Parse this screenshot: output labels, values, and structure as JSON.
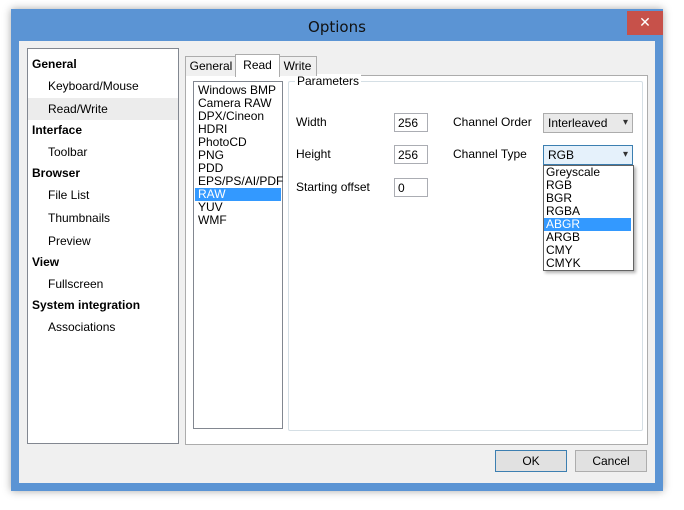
{
  "window": {
    "title": "Options",
    "close_glyph": "✕"
  },
  "nav": {
    "categories": [
      {
        "label": "General",
        "items": [
          "Keyboard/Mouse",
          "Read/Write"
        ]
      },
      {
        "label": "Interface",
        "items": [
          "Toolbar"
        ]
      },
      {
        "label": "Browser",
        "items": [
          "File List",
          "Thumbnails",
          "Preview"
        ]
      },
      {
        "label": "View",
        "items": [
          "Fullscreen"
        ]
      },
      {
        "label": "System integration",
        "items": [
          "Associations"
        ]
      }
    ],
    "selected": "Read/Write"
  },
  "tabs": {
    "items": [
      "General",
      "Read",
      "Write"
    ],
    "active": "Read"
  },
  "formats": {
    "items": [
      "Windows BMP",
      "Camera RAW",
      "DPX/Cineon",
      "HDRI",
      "PhotoCD",
      "PNG",
      "PDD",
      "EPS/PS/AI/PDF",
      "RAW",
      "YUV",
      "WMF"
    ],
    "selected": "RAW"
  },
  "parameters": {
    "legend": "Parameters",
    "width_label": "Width",
    "width_value": "256",
    "height_label": "Height",
    "height_value": "256",
    "offset_label": "Starting offset",
    "offset_value": "0",
    "channel_order_label": "Channel Order",
    "channel_order_value": "Interleaved",
    "channel_type_label": "Channel Type",
    "channel_type_value": "RGB",
    "channel_type_options": [
      "Greyscale",
      "RGB",
      "BGR",
      "RGBA",
      "ABGR",
      "ARGB",
      "CMY",
      "CMYK"
    ],
    "channel_type_highlighted": "ABGR"
  },
  "buttons": {
    "ok": "OK",
    "cancel": "Cancel"
  },
  "colors": {
    "titlebar": "#5b94d4",
    "selection": "#3399ff",
    "close": "#c7514a"
  }
}
